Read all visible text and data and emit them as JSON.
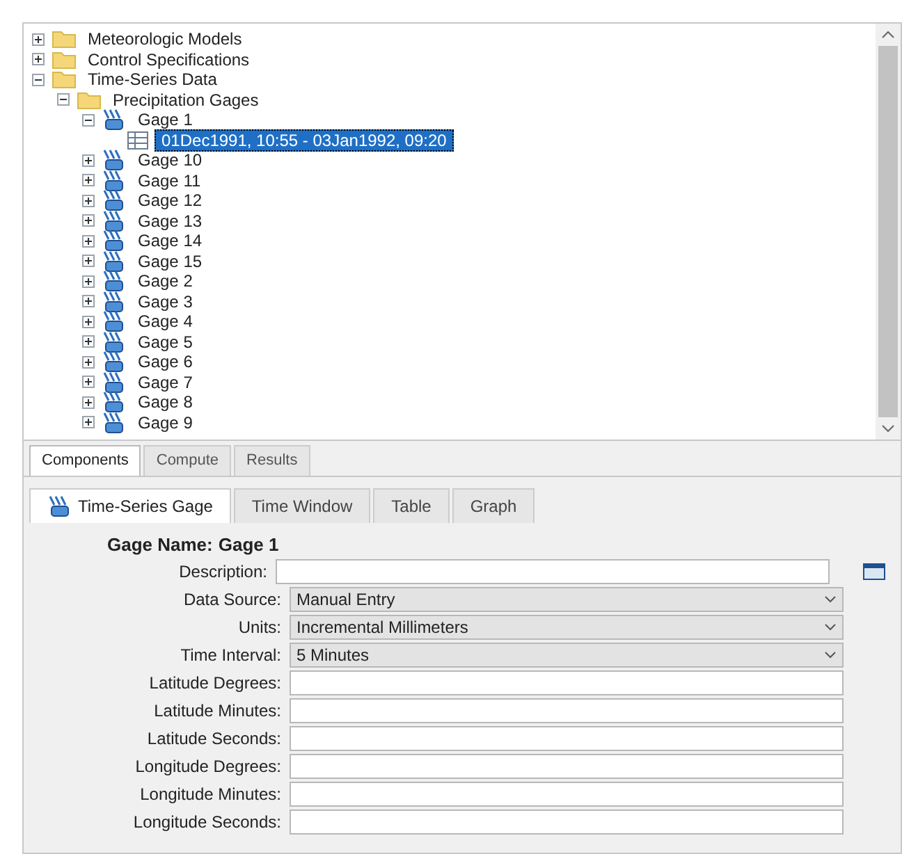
{
  "tree": [
    {
      "label": "Meteorologic Models",
      "kind": "folder",
      "expanded": false
    },
    {
      "label": "Control Specifications",
      "kind": "folder",
      "expanded": false
    },
    {
      "label": "Time-Series Data",
      "kind": "folder",
      "expanded": true,
      "children": [
        {
          "label": "Precipitation Gages",
          "kind": "folder",
          "expanded": true,
          "children": [
            {
              "label": "Gage 1",
              "kind": "gage",
              "expanded": true,
              "children": [
                {
                  "label": "01Dec1991, 10:55 - 03Jan1992, 09:20",
                  "kind": "record",
                  "selected": true
                }
              ]
            },
            {
              "label": "Gage 10",
              "kind": "gage",
              "expanded": false
            },
            {
              "label": "Gage 11",
              "kind": "gage",
              "expanded": false
            },
            {
              "label": "Gage 12",
              "kind": "gage",
              "expanded": false
            },
            {
              "label": "Gage 13",
              "kind": "gage",
              "expanded": false
            },
            {
              "label": "Gage 14",
              "kind": "gage",
              "expanded": false
            },
            {
              "label": "Gage 15",
              "kind": "gage",
              "expanded": false
            },
            {
              "label": "Gage 2",
              "kind": "gage",
              "expanded": false
            },
            {
              "label": "Gage 3",
              "kind": "gage",
              "expanded": false
            },
            {
              "label": "Gage 4",
              "kind": "gage",
              "expanded": false
            },
            {
              "label": "Gage 5",
              "kind": "gage",
              "expanded": false
            },
            {
              "label": "Gage 6",
              "kind": "gage",
              "expanded": false
            },
            {
              "label": "Gage 7",
              "kind": "gage",
              "expanded": false
            },
            {
              "label": "Gage 8",
              "kind": "gage",
              "expanded": false
            },
            {
              "label": "Gage 9",
              "kind": "gage",
              "expanded": false
            }
          ]
        }
      ]
    }
  ],
  "bottom_tabs": [
    {
      "label": "Components",
      "selected": true
    },
    {
      "label": "Compute",
      "selected": false
    },
    {
      "label": "Results",
      "selected": false
    }
  ],
  "editor_tabs": [
    {
      "label": "Time-Series Gage",
      "selected": true
    },
    {
      "label": "Time Window",
      "selected": false
    },
    {
      "label": "Table",
      "selected": false
    },
    {
      "label": "Graph",
      "selected": false
    }
  ],
  "gage_name": {
    "label": "Gage Name:",
    "value": "Gage 1"
  },
  "fields": [
    {
      "label": "Description:",
      "kind": "text"
    },
    {
      "label": "Data Source:",
      "kind": "select",
      "value": "Manual Entry"
    },
    {
      "label": "Units:",
      "kind": "select",
      "value": "Incremental Millimeters"
    },
    {
      "label": "Time Interval:",
      "kind": "select",
      "value": "5 Minutes"
    },
    {
      "label": "Latitude Degrees:",
      "kind": "text"
    },
    {
      "label": "Latitude Minutes:",
      "kind": "text"
    },
    {
      "label": "Latitude Seconds:",
      "kind": "text"
    },
    {
      "label": "Longitude Degrees:",
      "kind": "text"
    },
    {
      "label": "Longitude Minutes:",
      "kind": "text"
    },
    {
      "label": "Longitude Seconds:",
      "kind": "text"
    }
  ]
}
